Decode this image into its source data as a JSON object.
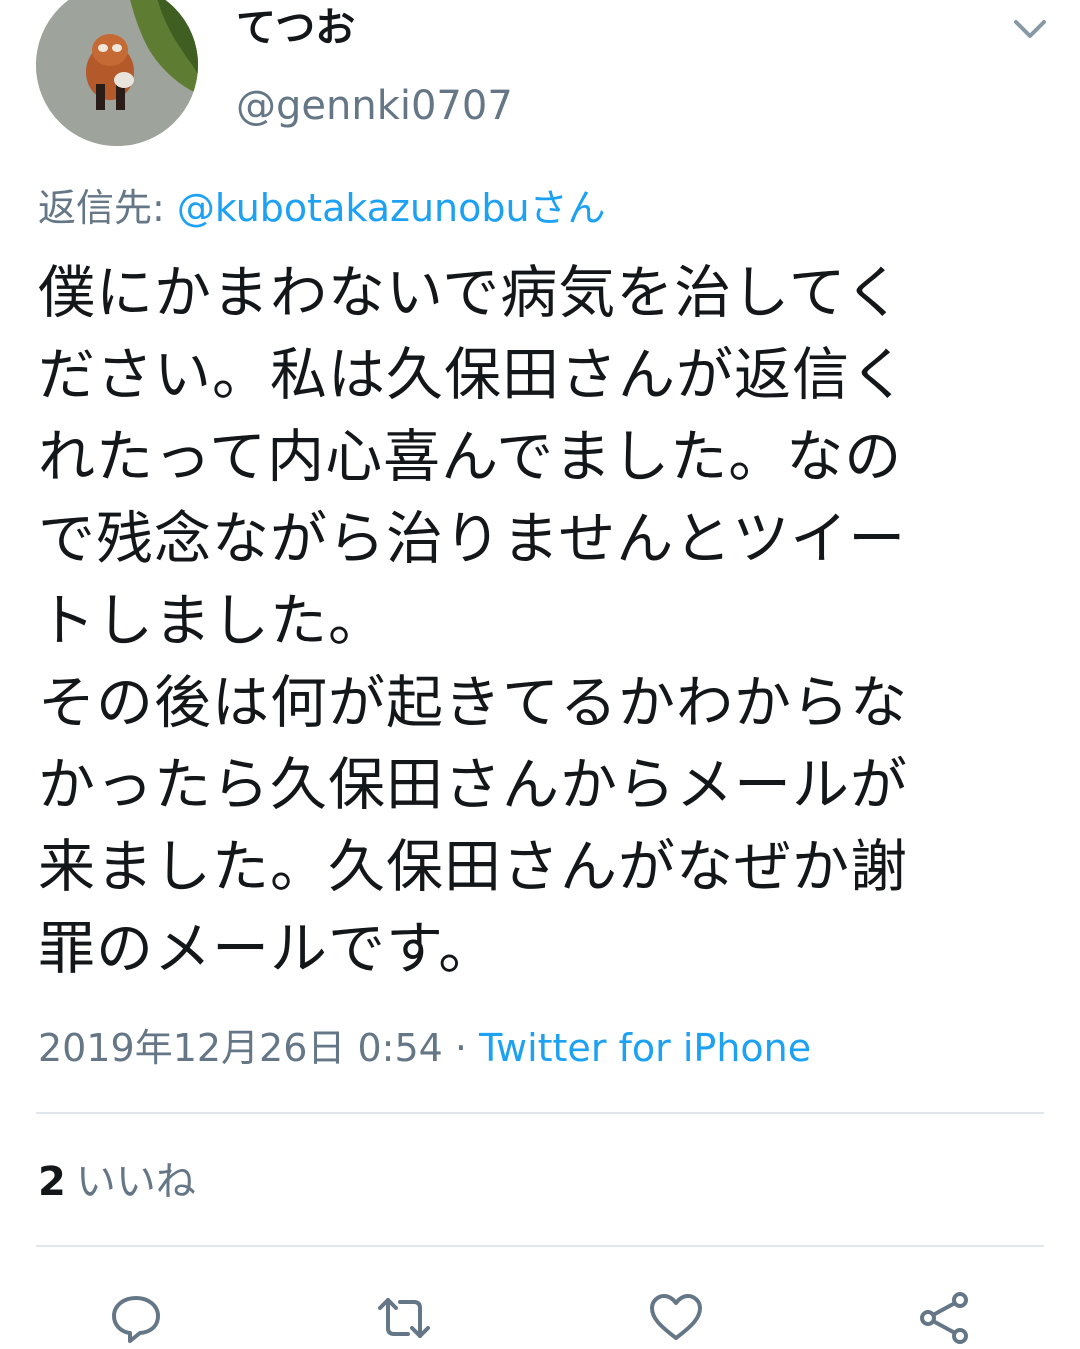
{
  "author": {
    "display_name": "てつお",
    "handle": "@gennki0707"
  },
  "reply": {
    "prefix": "返信先: ",
    "mention": "@kubotakazunobuさん"
  },
  "tweet": {
    "text": "僕にかまわないで病気を治してく\nださい。私は久保田さんが返信く\nれたって内心喜んでました。なの\nで残念ながら治りませんとツイー\nトしました。\nその後は何が起きてるかわからな\nかったら久保田さんからメールが\n来ました。久保田さんがなぜか謝\n罪のメールです。"
  },
  "meta": {
    "timestamp": "2019年12月26日 0:54",
    "separator": " · ",
    "source": "Twitter for iPhone"
  },
  "engagement": {
    "likes_count": "2",
    "likes_label": "いいね"
  },
  "icons": {
    "menu": "chevron-down-icon",
    "reply": "reply-icon",
    "retweet": "retweet-icon",
    "like": "heart-icon",
    "share": "share-icon"
  },
  "colors": {
    "accent": "#1da1f2",
    "secondary_text": "#657786",
    "icon": "#657786",
    "divider": "#e1e8ed"
  }
}
